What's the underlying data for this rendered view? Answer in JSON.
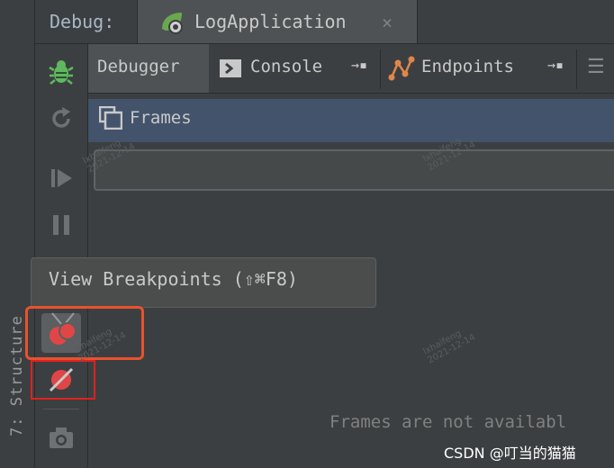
{
  "side_panel": {
    "label": "7: Structure"
  },
  "debug_bar": {
    "label": "Debug:",
    "run_tab": {
      "label": "LogApplication",
      "close_glyph": "×",
      "icon": "spring-boot-app-icon"
    }
  },
  "tabs": [
    {
      "label": "Debugger",
      "active": true
    },
    {
      "label": "Console",
      "pin_glyph": "→▪",
      "icon": "console-icon"
    },
    {
      "label": "Endpoints",
      "pin_glyph": "→▪",
      "icon": "endpoints-icon"
    }
  ],
  "more_glyph": "☰",
  "frames": {
    "label": "Frames",
    "empty_message": "Frames are not availabl"
  },
  "sidebar_icons": [
    "bug-icon",
    "rerun-icon",
    "resume-icon",
    "pause-icon",
    "view-breakpoints-icon",
    "mute-breakpoints-icon",
    "camera-icon"
  ],
  "tooltip": {
    "text": "View Breakpoints (⇧⌘F8)"
  },
  "watermarks": {
    "line1": "lxhaifeng",
    "line2": "2021-12-14"
  },
  "credit": "CSDN @叮当的猫猫",
  "colors": {
    "background": "#3c3f41",
    "active_tab": "#4e5254",
    "frames_header": "#42536b",
    "highlight_orange": "#e8522f",
    "highlight_red": "#e02020",
    "bug_green": "#5fb85f",
    "breakpoint_red": "#e04646"
  }
}
